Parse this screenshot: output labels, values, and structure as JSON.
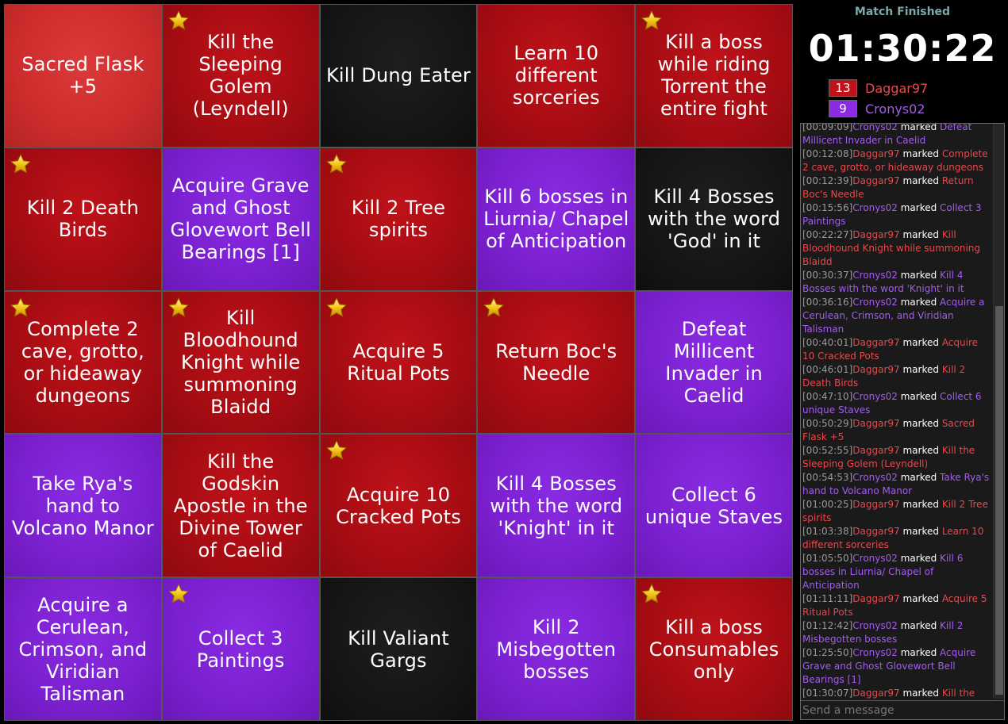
{
  "board": {
    "cells": [
      {
        "label": "Sacred Flask +5",
        "color": "red",
        "highlight": true,
        "star": false
      },
      {
        "label": "Kill the Sleeping Golem (Leyndell)",
        "color": "red",
        "star": true
      },
      {
        "label": "Kill Dung Eater",
        "color": "blank",
        "star": false
      },
      {
        "label": "Learn 10 different sorceries",
        "color": "red",
        "star": false
      },
      {
        "label": "Kill a boss while riding Torrent the entire fight",
        "color": "red",
        "star": true
      },
      {
        "label": "Kill 2 Death Birds",
        "color": "red",
        "star": true
      },
      {
        "label": "Acquire Grave and Ghost Glovewort Bell Bearings [1]",
        "color": "purple",
        "star": false
      },
      {
        "label": "Kill 2 Tree spirits",
        "color": "red",
        "star": true
      },
      {
        "label": "Kill 6 bosses in Liurnia/ Chapel of Anticipation",
        "color": "purple",
        "star": false
      },
      {
        "label": "Kill 4 Bosses with the word 'God' in it",
        "color": "blank",
        "star": false
      },
      {
        "label": "Complete 2 cave, grotto, or hideaway dungeons",
        "color": "red",
        "star": true
      },
      {
        "label": "Kill Bloodhound Knight while summoning Blaidd",
        "color": "red",
        "star": true
      },
      {
        "label": "Acquire 5 Ritual Pots",
        "color": "red",
        "star": true
      },
      {
        "label": "Return Boc's Needle",
        "color": "red",
        "star": true
      },
      {
        "label": "Defeat Millicent Invader in Caelid",
        "color": "purple",
        "star": false
      },
      {
        "label": "Take Rya's hand to Volcano Manor",
        "color": "purple",
        "star": false
      },
      {
        "label": "Kill the Godskin Apostle in the Divine Tower of Caelid",
        "color": "red",
        "star": false
      },
      {
        "label": "Acquire 10 Cracked Pots",
        "color": "red",
        "star": true
      },
      {
        "label": "Kill 4 Bosses with the word 'Knight' in it",
        "color": "purple",
        "star": false
      },
      {
        "label": "Collect 6 unique Staves",
        "color": "purple",
        "star": false
      },
      {
        "label": "Acquire a Cerulean, Crimson, and Viridian Talisman",
        "color": "purple",
        "star": false
      },
      {
        "label": "Collect 3 Paintings",
        "color": "purple",
        "star": true
      },
      {
        "label": "Kill Valiant Gargs",
        "color": "blank",
        "star": false
      },
      {
        "label": "Kill 2 Misbegotten bosses",
        "color": "purple",
        "star": false
      },
      {
        "label": "Kill a boss Consumables only",
        "color": "red",
        "star": true
      }
    ]
  },
  "sidebar": {
    "status": "Match Finished",
    "timer": "01:30:22",
    "players": [
      {
        "score": "13",
        "name": "Daggar97"
      },
      {
        "score": "9",
        "name": "Cronys02"
      }
    ]
  },
  "chat": {
    "verb": "marked",
    "placeholder": "Send a message",
    "log": [
      {
        "ts": "[00:09:09]",
        "who": "Cronys02",
        "p": "p2",
        "goal": "Defeat Millicent Invader in Caelid"
      },
      {
        "ts": "[00:12:08]",
        "who": "Daggar97",
        "p": "p1",
        "goal": "Complete 2 cave, grotto, or hideaway dungeons"
      },
      {
        "ts": "[00:12:39]",
        "who": "Daggar97",
        "p": "p1",
        "goal": "Return Boc's Needle"
      },
      {
        "ts": "[00:15:56]",
        "who": "Cronys02",
        "p": "p2",
        "goal": "Collect 3 Paintings"
      },
      {
        "ts": "[00:22:27]",
        "who": "Daggar97",
        "p": "p1",
        "goal": "Kill Bloodhound Knight while summoning Blaidd"
      },
      {
        "ts": "[00:30:37]",
        "who": "Cronys02",
        "p": "p2",
        "goal": "Kill 4 Bosses with the word 'Knight' in it"
      },
      {
        "ts": "[00:36:16]",
        "who": "Cronys02",
        "p": "p2",
        "goal": "Acquire a Cerulean, Crimson, and Viridian Talisman"
      },
      {
        "ts": "[00:40:01]",
        "who": "Daggar97",
        "p": "p1",
        "goal": "Acquire 10 Cracked Pots"
      },
      {
        "ts": "[00:46:01]",
        "who": "Daggar97",
        "p": "p1",
        "goal": "Kill 2 Death Birds"
      },
      {
        "ts": "[00:47:10]",
        "who": "Cronys02",
        "p": "p2",
        "goal": "Collect 6 unique Staves"
      },
      {
        "ts": "[00:50:29]",
        "who": "Daggar97",
        "p": "p1",
        "goal": "Sacred Flask +5"
      },
      {
        "ts": "[00:52:55]",
        "who": "Daggar97",
        "p": "p1",
        "goal": "Kill the Sleeping Golem (Leyndell)"
      },
      {
        "ts": "[00:54:53]",
        "who": "Cronys02",
        "p": "p2",
        "goal": "Take Rya's hand to Volcano Manor"
      },
      {
        "ts": "[01:00:25]",
        "who": "Daggar97",
        "p": "p1",
        "goal": "Kill 2 Tree spirits"
      },
      {
        "ts": "[01:03:38]",
        "who": "Daggar97",
        "p": "p1",
        "goal": "Learn 10 different sorceries"
      },
      {
        "ts": "[01:05:50]",
        "who": "Cronys02",
        "p": "p2",
        "goal": "Kill 6 bosses in Liurnia/ Chapel of Anticipation"
      },
      {
        "ts": "[01:11:11]",
        "who": "Daggar97",
        "p": "p1",
        "goal": "Acquire 5 Ritual Pots"
      },
      {
        "ts": "[01:12:42]",
        "who": "Cronys02",
        "p": "p2",
        "goal": "Kill 2 Misbegotten bosses"
      },
      {
        "ts": "[01:25:50]",
        "who": "Cronys02",
        "p": "p2",
        "goal": "Acquire Grave and Ghost Glovewort Bell Bearings [1]"
      },
      {
        "ts": "[01:30:07]",
        "who": "Daggar97",
        "p": "p1",
        "goal": "Kill the Godskin Apostle in the Divine Tower of Caelid"
      }
    ]
  },
  "icons": {
    "star": "star-icon"
  },
  "colors": {
    "red": "#a50c12",
    "red_highlight": "#cc2c2c",
    "purple": "#7a20cf",
    "blank": "#141414",
    "status": "#7fa8a8",
    "p1_text": "#e8484c",
    "p2_text": "#a45cf0"
  }
}
